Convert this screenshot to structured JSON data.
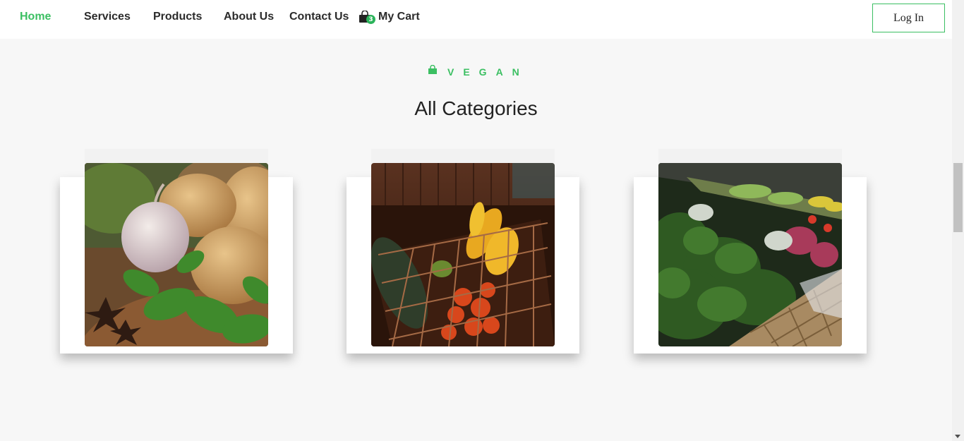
{
  "nav": {
    "items": [
      {
        "label": "Home",
        "active": true
      },
      {
        "label": "Services"
      },
      {
        "label": "Products"
      },
      {
        "label": "About Us"
      },
      {
        "label": "Contact Us"
      }
    ],
    "cart": {
      "label": "My Cart",
      "count": "3",
      "icon": "shopping-bag-icon"
    },
    "login_label": "Log In"
  },
  "section": {
    "eyebrow": "VEGAN",
    "eyebrow_icon": "shopping-bag-icon",
    "title": "All Categories"
  },
  "categories": [
    {
      "image": "vegetables-garlic-potatoes-photo"
    },
    {
      "image": "vegetable-basket-photo"
    },
    {
      "image": "produce-shelf-greens-photo"
    }
  ],
  "colors": {
    "accent": "#3bbf62",
    "text": "#2b2b2b",
    "background": "#f7f7f7"
  }
}
